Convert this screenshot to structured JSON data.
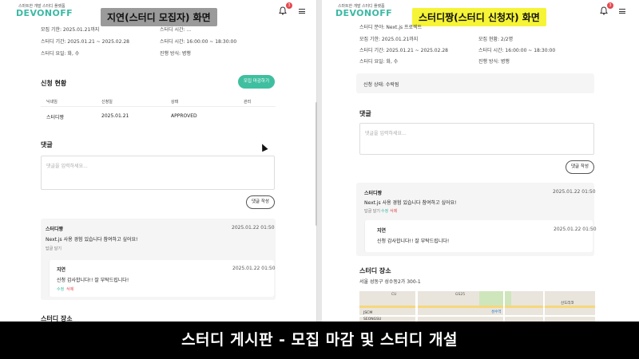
{
  "app": {
    "tagline": "스마트한 개발 스터디 플랫폼",
    "logo": "DEVONOFF"
  },
  "left": {
    "caption": "지연(스터디 모집자) 화면",
    "notif_count": "3",
    "info": {
      "recruit_period": "모집 기한: 2025.01.21까지",
      "study_period": "스터디 기간: 2025.01.21 ~ 2025.02.28",
      "study_days": "스터디 요일: 화, 수",
      "top_right": "스터디 시간: ...",
      "study_time": "스터디 시간: 16:00:00 ~ 18:30:00",
      "method": "진행 방식: 병행"
    },
    "applications": {
      "title": "신청 현황",
      "close_button": "모집 마감하기",
      "headers": [
        "닉네임",
        "신청일",
        "상태",
        "관리"
      ],
      "rows": [
        {
          "nickname": "스터디짱",
          "date": "2025.01.21",
          "status": "APPROVED",
          "manage": ""
        }
      ]
    },
    "comments": {
      "title": "댓글",
      "placeholder": "댓글을 입력하세요...",
      "submit": "댓글 작성",
      "items": [
        {
          "author": "스터디짱",
          "time": "2025.01.22 01:50",
          "body": "Next.js 사용 경험 있습니다 참여하고 싶어요!",
          "reply": "답글 달기"
        }
      ],
      "replies": [
        {
          "author": "지연",
          "time": "2025.01.22 01:50",
          "body": "신청 감사합니다!! 잘 부탁드립니다!",
          "edit": "수정",
          "delete": "삭제"
        }
      ]
    },
    "location_title": "스터디 장소"
  },
  "right": {
    "caption": "스터디짱(스터디 신청자) 화면",
    "notif_count": "3",
    "info": {
      "category": "스터디 분야: Next.js 프로젝트",
      "recruit_period": "모집 기한: 2025.01.21까지",
      "study_period": "스터디 기간: 2025.01.21 ~ 2025.02.28",
      "study_days": "스터디 요일: 화, 수",
      "capacity": "모집 현황: 2/2명",
      "study_time": "스터디 시간: 16:00:00 ~ 18:30:00",
      "method": "진행 방식: 병행"
    },
    "apply_status": "신청 상태: 수락됨",
    "comments": {
      "title": "댓글",
      "placeholder": "댓글을 입력하세요...",
      "submit": "댓글 작성",
      "items": [
        {
          "author": "스터디짱",
          "time": "2025.01.22 01:50",
          "body": "Next.js 사용 경험 있습니다 참여하고 싶어요!",
          "reply": "답글 달기",
          "edit": "수정",
          "delete": "삭제"
        }
      ],
      "replies": [
        {
          "author": "지연",
          "time": "2025.01.22 01:50",
          "body": "신청 감사합니다!! 잘 부탁드립니다!"
        }
      ]
    },
    "location": {
      "title": "스터디 장소",
      "address": "서울 성동구 성수동2가 300-1"
    },
    "map_labels": [
      "CU",
      "GS25",
      "성수역",
      "JSCM",
      "SEONGSU",
      "신도리코"
    ]
  },
  "banner": "스터디 게시판 - 모집 마감 및 스터디 개설"
}
